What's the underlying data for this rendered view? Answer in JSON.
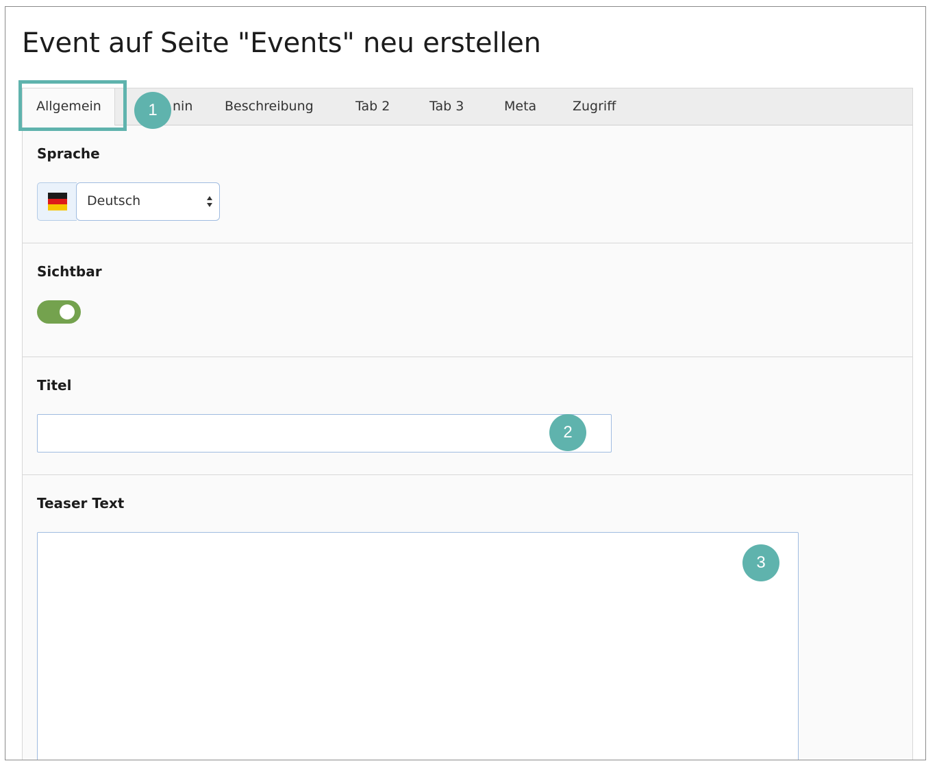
{
  "page": {
    "title": "Event auf Seite \"Events\" neu erstellen"
  },
  "tabs": [
    {
      "label": "Allgemein",
      "active": true
    },
    {
      "label": "Termin"
    },
    {
      "label": "Beschreibung"
    },
    {
      "label": "Tab 2"
    },
    {
      "label": "Tab 3"
    },
    {
      "label": "Meta"
    },
    {
      "label": "Zugriff"
    }
  ],
  "visible_tab_fragments": {
    "termin_partial": "nin"
  },
  "fields": {
    "sprache": {
      "label": "Sprache",
      "value": "Deutsch",
      "flag_icon": "germany-flag-icon"
    },
    "sichtbar": {
      "label": "Sichtbar",
      "toggle_on": true,
      "toggle_color": "#74a24e"
    },
    "titel": {
      "label": "Titel",
      "value": ""
    },
    "teaser": {
      "label": "Teaser Text",
      "value": ""
    }
  },
  "markers": [
    "1",
    "2",
    "3"
  ],
  "colors": {
    "accent": "#5fb3ad",
    "input_border": "#9fbbe0"
  }
}
